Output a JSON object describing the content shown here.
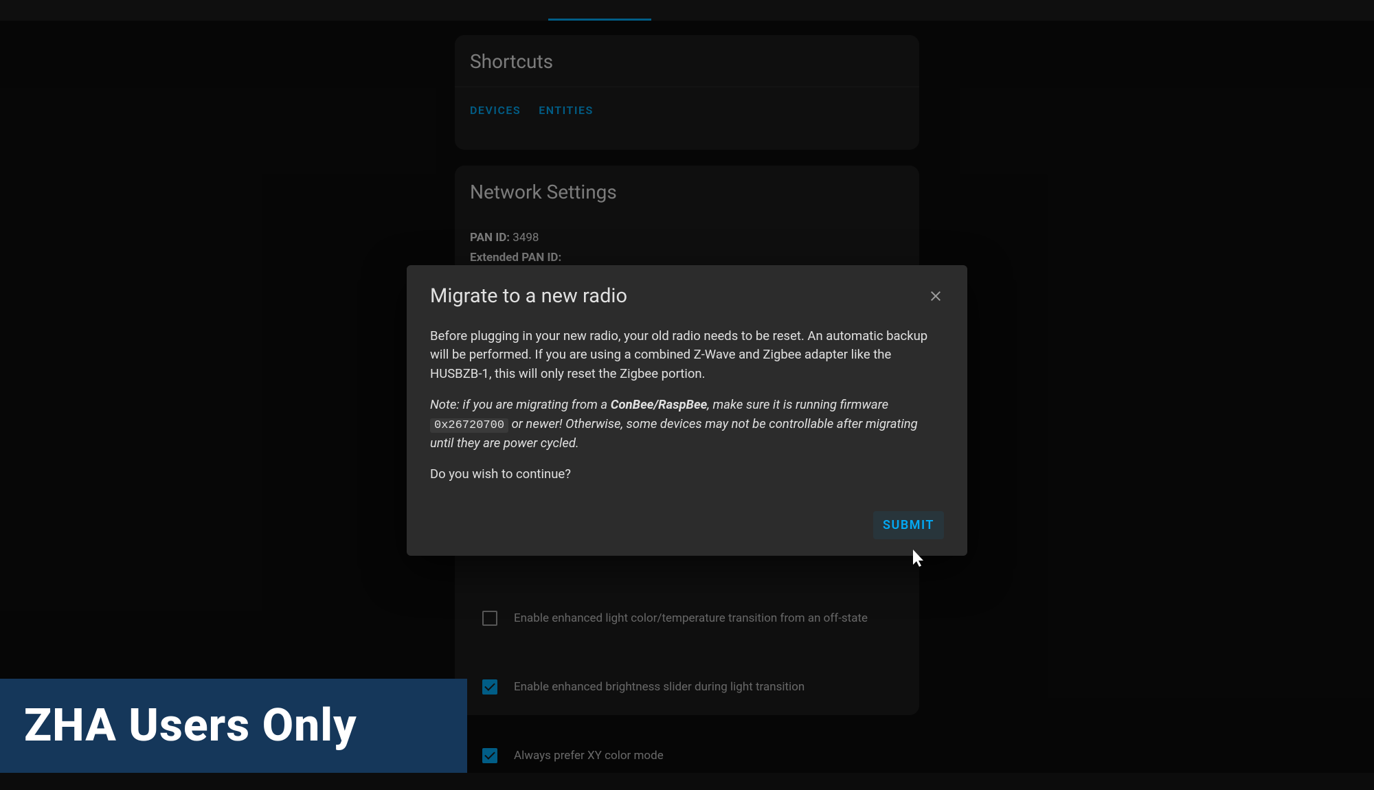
{
  "shortcuts": {
    "title": "Shortcuts",
    "devices_btn": "DEVICES",
    "entities_btn": "ENTITIES"
  },
  "network": {
    "title": "Network Settings",
    "pan_id_label": "PAN ID:",
    "pan_id_value": "3498",
    "ext_pan_id_label": "Extended PAN ID:"
  },
  "settings": {
    "enhanced_color": "Enable enhanced light color/temperature transition from an off-state",
    "enhanced_brightness": "Enable enhanced brightness slider during light transition",
    "xy_color": "Always prefer XY color mode"
  },
  "modal": {
    "title": "Migrate to a new radio",
    "para1": "Before plugging in your new radio, your old radio needs to be reset. An automatic backup will be performed. If you are using a combined Z-Wave and Zigbee adapter like the HUSBZB-1, this will only reset the Zigbee portion.",
    "note_prefix": "Note: if you are migrating from a ",
    "note_bold": "ConBee/RaspBee",
    "note_mid": ", make sure it is running firmware ",
    "note_code": "0x26720700",
    "note_suffix": " or newer! Otherwise, some devices may not be controllable after migrating until they are power cycled.",
    "continue": "Do you wish to continue?",
    "submit": "SUBMIT"
  },
  "banner": {
    "text": "ZHA Users Only"
  }
}
